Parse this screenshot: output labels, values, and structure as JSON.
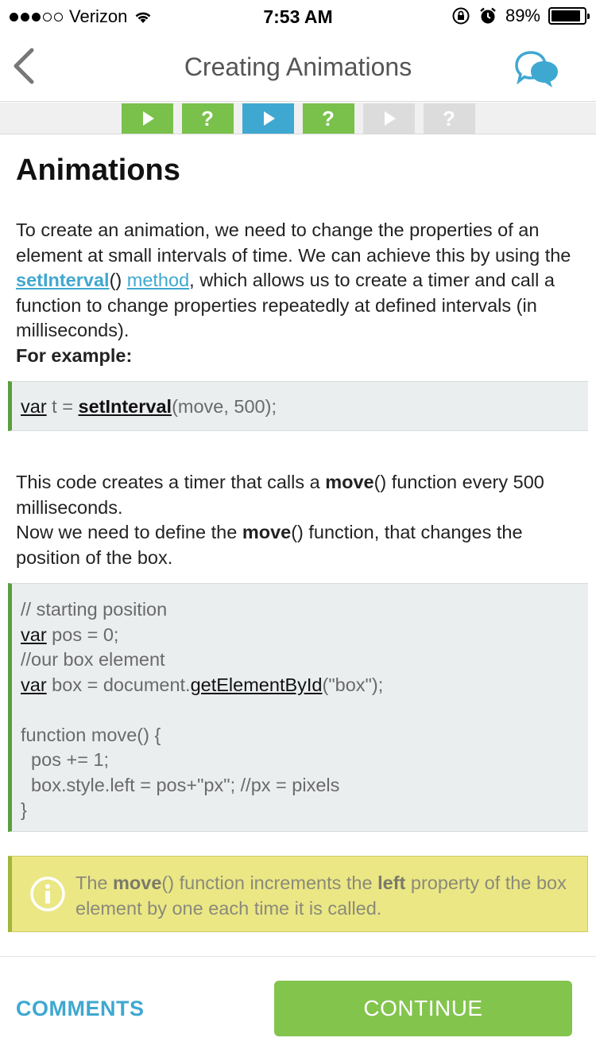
{
  "status_bar": {
    "carrier": "Verizon",
    "time": "7:53 AM",
    "battery": "89%",
    "battery_level": 0.89,
    "signal_bars": 3,
    "signal_total": 5
  },
  "nav": {
    "title": "Creating Animations",
    "back_icon": "chevron-left-icon",
    "chat_icon": "chat-bubbles-icon"
  },
  "progress": {
    "steps": [
      {
        "type": "lesson",
        "state": "done"
      },
      {
        "type": "quiz",
        "label": "?",
        "state": "done"
      },
      {
        "type": "lesson",
        "state": "current"
      },
      {
        "type": "quiz",
        "label": "?",
        "state": "done"
      },
      {
        "type": "lesson",
        "state": "todo"
      },
      {
        "type": "quiz",
        "label": "?",
        "state": "todo"
      }
    ]
  },
  "content": {
    "heading": "Animations",
    "intro": {
      "part1": "To create an animation, we need to change the properties of an element at small intervals of time. We can achieve this by using the ",
      "link1": "setInterval",
      "part2": "() ",
      "link2": "method",
      "part3": ", which allows us to create a timer and call a function to change properties repeatedly at defined intervals (in milliseconds).",
      "example_label": "For example:"
    },
    "code1": {
      "kw": "var",
      "mid": " t = ",
      "fn": "setInterval",
      "rest": "(move, 500);"
    },
    "explain": {
      "p1a": "This code creates a timer that calls a ",
      "p1b": "move",
      "p1c": "() function every 500 milliseconds.",
      "p2a": "Now we need to define the ",
      "p2b": "move",
      "p2c": "() function, that changes the position of the box."
    },
    "code2": {
      "line1": "// starting position",
      "line2_kw": "var",
      "line2_rest": " pos = 0;",
      "line3": "//our box element",
      "line4_kw": "var",
      "line4_mid": " box = document.",
      "line4_method": "getElementById",
      "line4_rest": "(\"box\");",
      "line6": "function move() {",
      "line7": "  pos += 1;",
      "line8": "  box.style.left = pos+\"px\"; //px = pixels",
      "line9": "}"
    },
    "note": {
      "icon": "info-icon",
      "t1": "The ",
      "b1": "move",
      "t2": "() function increments the ",
      "b2": "left",
      "t3": " property of the box element by one each time it is called."
    }
  },
  "bottom": {
    "comments_label": "COMMENTS",
    "continue_label": "CONTINUE"
  },
  "colors": {
    "accent": "#3fa8d0",
    "done": "#79c14b",
    "continue": "#83c44d",
    "note_bg": "#ebe785"
  }
}
